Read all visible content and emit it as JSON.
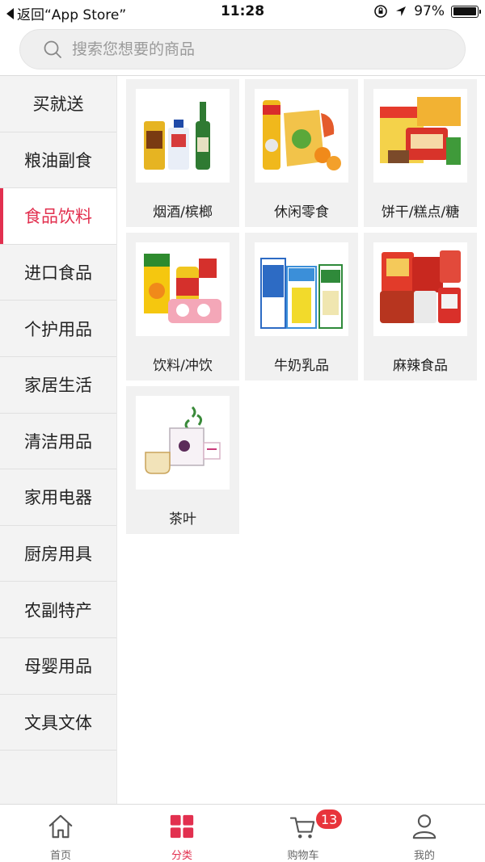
{
  "status_bar": {
    "back_label": "返回“App Store”",
    "time": "11:28",
    "battery_text": "97%",
    "battery_level": 0.97
  },
  "search": {
    "placeholder": "搜索您想要的商品"
  },
  "sidebar": {
    "items": [
      {
        "label": "买就送"
      },
      {
        "label": "粮油副食"
      },
      {
        "label": "食品饮料",
        "active": true
      },
      {
        "label": "进口食品"
      },
      {
        "label": "个护用品"
      },
      {
        "label": "家居生活"
      },
      {
        "label": "清洁用品"
      },
      {
        "label": "家用电器"
      },
      {
        "label": "厨房用具"
      },
      {
        "label": "农副特产"
      },
      {
        "label": "母婴用品"
      },
      {
        "label": "文具文体"
      }
    ]
  },
  "categories": [
    {
      "label": "烟酒/槟榔",
      "icon": "liquor-product-image"
    },
    {
      "label": "休闲零食",
      "icon": "snacks-product-image"
    },
    {
      "label": "饼干/糕点/糖",
      "icon": "biscuits-product-image"
    },
    {
      "label": "饮料/冲饮",
      "icon": "beverage-product-image"
    },
    {
      "label": "牛奶乳品",
      "icon": "milk-product-image"
    },
    {
      "label": "麻辣食品",
      "icon": "spicy-food-product-image"
    },
    {
      "label": "茶叶",
      "icon": "tea-product-image"
    }
  ],
  "tabbar": {
    "tabs": [
      {
        "label": "首页",
        "icon": "home-icon"
      },
      {
        "label": "分类",
        "icon": "category-grid-icon",
        "active": true
      },
      {
        "label": "购物车",
        "icon": "cart-icon"
      },
      {
        "label": "我的",
        "icon": "user-icon"
      }
    ],
    "cart_badge": "13"
  },
  "colors": {
    "accent": "#e2304f",
    "badge": "#e8343b",
    "sidebar_bg": "#f3f3f3",
    "cell_bg": "#f1f1f1"
  }
}
